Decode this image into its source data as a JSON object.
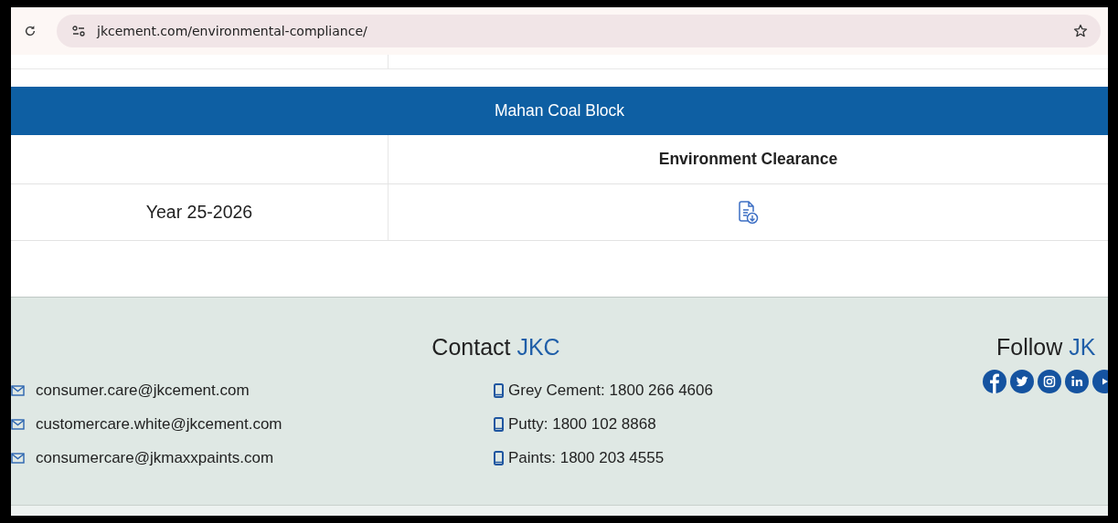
{
  "browser": {
    "url": "jkcement.com/environmental-compliance/"
  },
  "table": {
    "section_title": "Mahan Coal Block",
    "column_heading": "Environment Clearance",
    "rows": [
      {
        "label": "Year 25-2026"
      }
    ]
  },
  "footer": {
    "contact": {
      "title": "Contact",
      "highlight": "JKC"
    },
    "emails": [
      "consumer.care@jkcement.com",
      "customercare.white@jkcement.com",
      "consumercare@jkmaxxpaints.com"
    ],
    "phones": [
      "Grey Cement: 1800 266 4606",
      "Putty: 1800 102 8868",
      "Paints: 1800 203 4555"
    ],
    "follow": {
      "title": "Follow",
      "highlight": "JK"
    },
    "social": [
      {
        "kind": "facebook"
      },
      {
        "kind": "twitter"
      },
      {
        "kind": "instagram"
      },
      {
        "kind": "linkedin"
      },
      {
        "kind": "youtube"
      }
    ]
  }
}
